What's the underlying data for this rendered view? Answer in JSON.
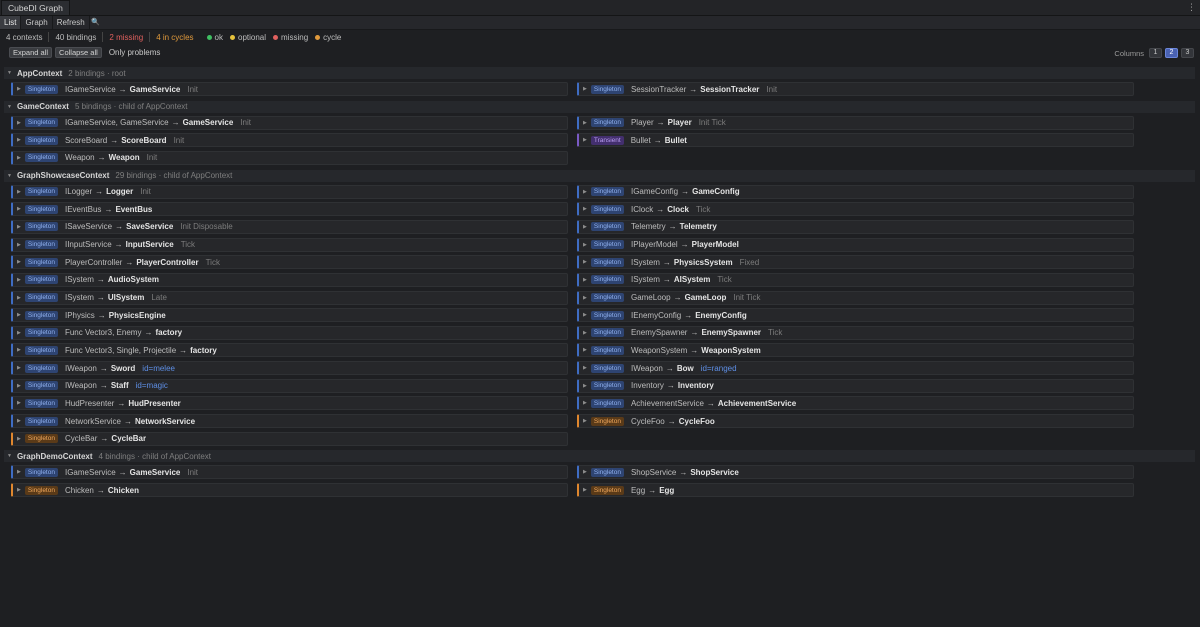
{
  "window": {
    "tab_title": "CubeDI Graph",
    "menu_icon": "⋮"
  },
  "toolbar": {
    "list": "List",
    "graph": "Graph",
    "refresh": "Refresh",
    "search_icon": "🔍"
  },
  "stats": {
    "contexts": "4 contexts",
    "bindings": "40 bindings",
    "missing": "2 missing",
    "cycles": "4 in cycles"
  },
  "legend": [
    {
      "label": "ok",
      "color": "#3fbf62"
    },
    {
      "label": "optional",
      "color": "#e6c23c"
    },
    {
      "label": "missing",
      "color": "#e0605e"
    },
    {
      "label": "cycle",
      "color": "#e19a3c"
    }
  ],
  "controls": {
    "expand_all": "Expand all",
    "collapse_all": "Collapse all",
    "only_problems": "Only problems"
  },
  "columns": {
    "label": "Columns",
    "options": [
      "1",
      "2",
      "3"
    ],
    "selected": "2"
  },
  "sections": [
    {
      "name": "AppContext",
      "meta": "2 bindings · root",
      "bindings": [
        {
          "lifetime": "Singleton",
          "iface": "IGameService",
          "impl": "GameService",
          "tags": "Init",
          "id": ""
        },
        {
          "lifetime": "Singleton",
          "iface": "SessionTracker",
          "impl": "SessionTracker",
          "tags": "Init",
          "id": ""
        }
      ]
    },
    {
      "name": "GameContext",
      "meta": "5 bindings · child of AppContext",
      "bindings": [
        {
          "lifetime": "Singleton",
          "iface": "IGameService, GameService",
          "impl": "GameService",
          "tags": "Init",
          "id": ""
        },
        {
          "lifetime": "Singleton",
          "iface": "Player",
          "impl": "Player",
          "tags": "Init Tick",
          "id": ""
        },
        {
          "lifetime": "Singleton",
          "iface": "ScoreBoard",
          "impl": "ScoreBoard",
          "tags": "Init",
          "id": ""
        },
        {
          "lifetime": "Transient",
          "iface": "Bullet",
          "impl": "Bullet",
          "tags": "",
          "id": ""
        },
        {
          "lifetime": "Singleton",
          "iface": "Weapon",
          "impl": "Weapon",
          "tags": "Init",
          "id": ""
        }
      ]
    },
    {
      "name": "GraphShowcaseContext",
      "meta": "29 bindings · child of AppContext",
      "bindings": [
        {
          "lifetime": "Singleton",
          "iface": "ILogger",
          "impl": "Logger",
          "tags": "Init",
          "id": ""
        },
        {
          "lifetime": "Singleton",
          "iface": "IGameConfig",
          "impl": "GameConfig",
          "tags": "",
          "id": ""
        },
        {
          "lifetime": "Singleton",
          "iface": "IEventBus",
          "impl": "EventBus",
          "tags": "",
          "id": ""
        },
        {
          "lifetime": "Singleton",
          "iface": "IClock",
          "impl": "Clock",
          "tags": "Tick",
          "id": ""
        },
        {
          "lifetime": "Singleton",
          "iface": "ISaveService",
          "impl": "SaveService",
          "tags": "Init Disposable",
          "id": ""
        },
        {
          "lifetime": "Singleton",
          "iface": "Telemetry",
          "impl": "Telemetry",
          "tags": "",
          "id": ""
        },
        {
          "lifetime": "Singleton",
          "iface": "IInputService",
          "impl": "InputService",
          "tags": "Tick",
          "id": ""
        },
        {
          "lifetime": "Singleton",
          "iface": "IPlayerModel",
          "impl": "PlayerModel",
          "tags": "",
          "id": ""
        },
        {
          "lifetime": "Singleton",
          "iface": "PlayerController",
          "impl": "PlayerController",
          "tags": "Tick",
          "id": ""
        },
        {
          "lifetime": "Singleton",
          "iface": "ISystem",
          "impl": "PhysicsSystem",
          "tags": "Fixed",
          "id": ""
        },
        {
          "lifetime": "Singleton",
          "iface": "ISystem",
          "impl": "AudioSystem",
          "tags": "",
          "id": ""
        },
        {
          "lifetime": "Singleton",
          "iface": "ISystem",
          "impl": "AISystem",
          "tags": "Tick",
          "id": ""
        },
        {
          "lifetime": "Singleton",
          "iface": "ISystem",
          "impl": "UISystem",
          "tags": "Late",
          "id": ""
        },
        {
          "lifetime": "Singleton",
          "iface": "GameLoop",
          "impl": "GameLoop",
          "tags": "Init Tick",
          "id": ""
        },
        {
          "lifetime": "Singleton",
          "iface": "IPhysics",
          "impl": "PhysicsEngine",
          "tags": "",
          "id": ""
        },
        {
          "lifetime": "Singleton",
          "iface": "IEnemyConfig",
          "impl": "EnemyConfig",
          "tags": "",
          "id": ""
        },
        {
          "lifetime": "Singleton",
          "iface": "Func Vector3, Enemy ",
          "impl": "factory",
          "tags": "",
          "id": ""
        },
        {
          "lifetime": "Singleton",
          "iface": "EnemySpawner",
          "impl": "EnemySpawner",
          "tags": "Tick",
          "id": ""
        },
        {
          "lifetime": "Singleton",
          "iface": "Func Vector3, Single, Projectile ",
          "impl": "factory",
          "tags": "",
          "id": ""
        },
        {
          "lifetime": "Singleton",
          "iface": "WeaponSystem",
          "impl": "WeaponSystem",
          "tags": "",
          "id": ""
        },
        {
          "lifetime": "Singleton",
          "iface": "IWeapon",
          "impl": "Sword",
          "tags": "",
          "id": "id=melee"
        },
        {
          "lifetime": "Singleton",
          "iface": "IWeapon",
          "impl": "Bow",
          "tags": "",
          "id": "id=ranged"
        },
        {
          "lifetime": "Singleton",
          "iface": "IWeapon",
          "impl": "Staff",
          "tags": "",
          "id": "id=magic"
        },
        {
          "lifetime": "Singleton",
          "iface": "Inventory",
          "impl": "Inventory",
          "tags": "",
          "id": ""
        },
        {
          "lifetime": "Singleton",
          "iface": "HudPresenter",
          "impl": "HudPresenter",
          "tags": "",
          "id": ""
        },
        {
          "lifetime": "Singleton",
          "iface": "AchievementService",
          "impl": "AchievementService",
          "tags": "",
          "id": ""
        },
        {
          "lifetime": "Singleton",
          "iface": "NetworkService",
          "impl": "NetworkService",
          "tags": "",
          "id": ""
        },
        {
          "lifetime": "Singleton",
          "iface": "CycleFoo",
          "impl": "CycleFoo",
          "tags": "",
          "id": "",
          "cycle": true
        },
        {
          "lifetime": "Singleton",
          "iface": "CycleBar",
          "impl": "CycleBar",
          "tags": "",
          "id": "",
          "cycle": true
        }
      ]
    },
    {
      "name": "GraphDemoContext",
      "meta": "4 bindings · child of AppContext",
      "bindings": [
        {
          "lifetime": "Singleton",
          "iface": "IGameService",
          "impl": "GameService",
          "tags": "Init",
          "id": ""
        },
        {
          "lifetime": "Singleton",
          "iface": "ShopService",
          "impl": "ShopService",
          "tags": "",
          "id": ""
        },
        {
          "lifetime": "Singleton",
          "iface": "Chicken",
          "impl": "Chicken",
          "tags": "",
          "id": "",
          "cycle": true
        },
        {
          "lifetime": "Singleton",
          "iface": "Egg",
          "impl": "Egg",
          "tags": "",
          "id": "",
          "cycle": true
        }
      ]
    }
  ]
}
